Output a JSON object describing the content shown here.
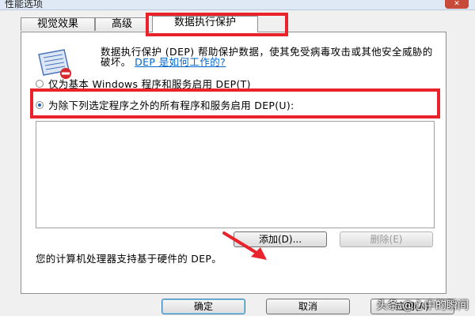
{
  "window": {
    "title": "性能选项",
    "close_glyph": "✕"
  },
  "tabs": [
    {
      "label": "视觉效果"
    },
    {
      "label": "高级"
    },
    {
      "label": "数据执行保护"
    }
  ],
  "description": {
    "text": "数据执行保护 (DEP) 帮助保护数据，使其免受病毒攻击或其他安全威胁的破坏。",
    "link": "DEP 是如何工作的?"
  },
  "options": {
    "basic": "仅为基本 Windows 程序和服务启用 DEP(T)",
    "all_except": "为除下列选定程序之外的所有程序和服务启用 DEP(U):"
  },
  "buttons": {
    "add": "添加(D)...",
    "remove": "删除(E)",
    "ok": "确定",
    "cancel": "取消",
    "apply": "应用(A)"
  },
  "support_text": "您的计算机处理器支持基于硬件的 DEP。",
  "watermark": "头条 @心中的瞬间",
  "colors": {
    "highlight": "#e8232b",
    "link": "#0066cc"
  }
}
